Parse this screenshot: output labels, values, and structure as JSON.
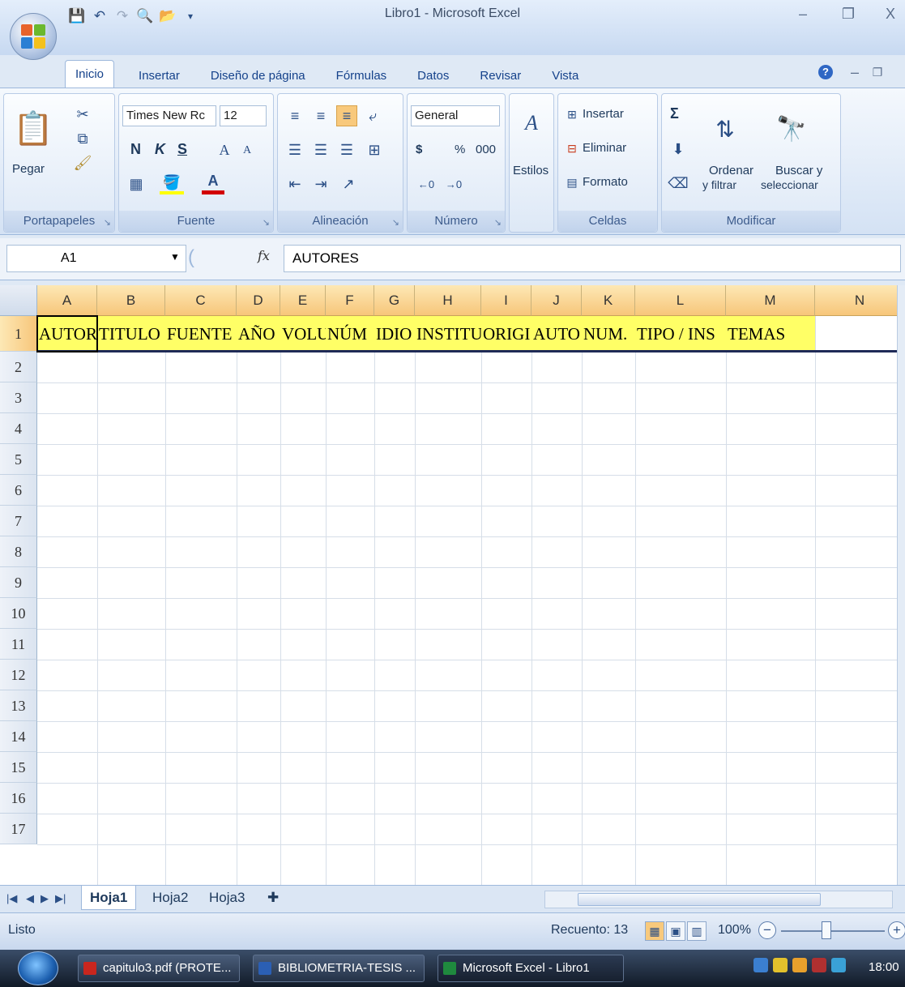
{
  "window": {
    "title": "Libro1 - Microsoft Excel",
    "controls": {
      "minimize": "–",
      "restore": "❐",
      "close": "X"
    }
  },
  "ribbon_tabs": [
    "Inicio",
    "Insertar",
    "Diseño de página",
    "Fórmulas",
    "Datos",
    "Revisar",
    "Vista"
  ],
  "ribbon": {
    "portapapeles": {
      "label": "Portapapeles",
      "paste": "Pegar"
    },
    "fuente": {
      "label": "Fuente",
      "font_name": "Times New Rc",
      "font_size": "12",
      "bold": "N",
      "italic": "K",
      "underline": "S"
    },
    "alineacion": {
      "label": "Alineación"
    },
    "numero": {
      "label": "Número",
      "format": "General",
      "currency": "$",
      "percent": "%",
      "thousands": "000"
    },
    "estilos": {
      "label": "Estilos"
    },
    "celdas": {
      "label": "Celdas",
      "insert": "Insertar",
      "delete": "Eliminar",
      "format": "Formato"
    },
    "modificar": {
      "label": "Modificar",
      "sort": "Ordenar",
      "sort2": "y filtrar",
      "find": "Buscar y",
      "find2": "seleccionar",
      "sigma": "Σ"
    }
  },
  "formula_bar": {
    "name_box": "A1",
    "fx": "fx",
    "formula": "AUTORES"
  },
  "columns": [
    "A",
    "B",
    "C",
    "D",
    "E",
    "F",
    "G",
    "H",
    "I",
    "J",
    "K",
    "L",
    "M",
    "N"
  ],
  "rows": [
    "1",
    "2",
    "3",
    "4",
    "5",
    "6",
    "7",
    "8",
    "9",
    "10",
    "11",
    "12",
    "13",
    "14",
    "15",
    "16",
    "17"
  ],
  "row1_cells": [
    "AUTOR",
    "TITULO",
    "FUENTE",
    "AÑO",
    "VOLU",
    "NÚM",
    "IDIO",
    "INSTITU",
    "ORIGI",
    "AUTO",
    "NUM.",
    "TIPO / INS",
    "TEMAS"
  ],
  "sheets": [
    "Hoja1",
    "Hoja2",
    "Hoja3"
  ],
  "status": {
    "ready": "Listo",
    "count": "Recuento: 13",
    "zoom": "100%",
    "zoom_out": "−",
    "zoom_in": "+"
  },
  "taskbar": {
    "items": [
      "capitulo3.pdf (PROTE...",
      "BIBLIOMETRIA-TESIS ...",
      "Microsoft Excel - Libro1"
    ],
    "clock": "18:00"
  },
  "colors": {
    "header_highlight": "#f7c67a",
    "row1_fill": "#ffff66",
    "ribbon_text": "#15428b"
  }
}
